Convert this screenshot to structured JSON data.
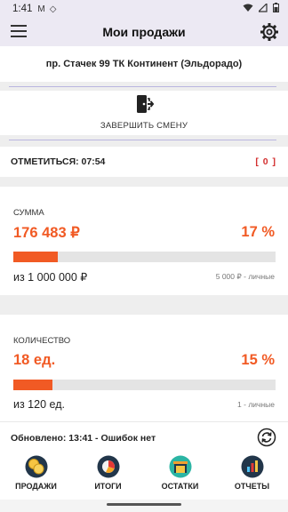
{
  "status_bar": {
    "time": "1:41",
    "icons": [
      "gmail-icon",
      "sync-icon",
      "wifi-icon",
      "signal-icon",
      "battery-icon"
    ]
  },
  "app_bar": {
    "title": "Мои продажи"
  },
  "store": {
    "name": "пр. Стачек 99 ТК Континент (Эльдорадо)"
  },
  "shift": {
    "end_label": "ЗАВЕРШИТЬ СМЕНУ"
  },
  "checkin": {
    "label": "ОТМЕТИТЬСЯ: 07:54",
    "counter": "[ 0 ]"
  },
  "sum_card": {
    "caption": "СУММА",
    "value": "176 483 ₽",
    "percent": "17 %",
    "progress_fraction": 0.17,
    "target": "из 1 000 000 ₽",
    "personal": "5 000 ₽ - личные"
  },
  "qty_card": {
    "caption": "КОЛИЧЕСТВО",
    "value": "18 ед.",
    "percent": "15 %",
    "progress_fraction": 0.15,
    "target": "из 120 ед.",
    "personal": "1 - личные"
  },
  "update": {
    "text": "Обновлено: 13:41 - Ошибок нет"
  },
  "tabs": [
    {
      "label": "ПРОДАЖИ",
      "icon": "coins-icon"
    },
    {
      "label": "ИТОГИ",
      "icon": "pie-chart-icon"
    },
    {
      "label": "ОСТАТКИ",
      "icon": "warehouse-icon"
    },
    {
      "label": "ОТЧЕТЫ",
      "icon": "bar-report-icon"
    }
  ],
  "colors": {
    "accent": "#f15a24",
    "counter": "#d32f2f",
    "divider": "#b9b6e0",
    "header_bg": "#ece9f3"
  }
}
